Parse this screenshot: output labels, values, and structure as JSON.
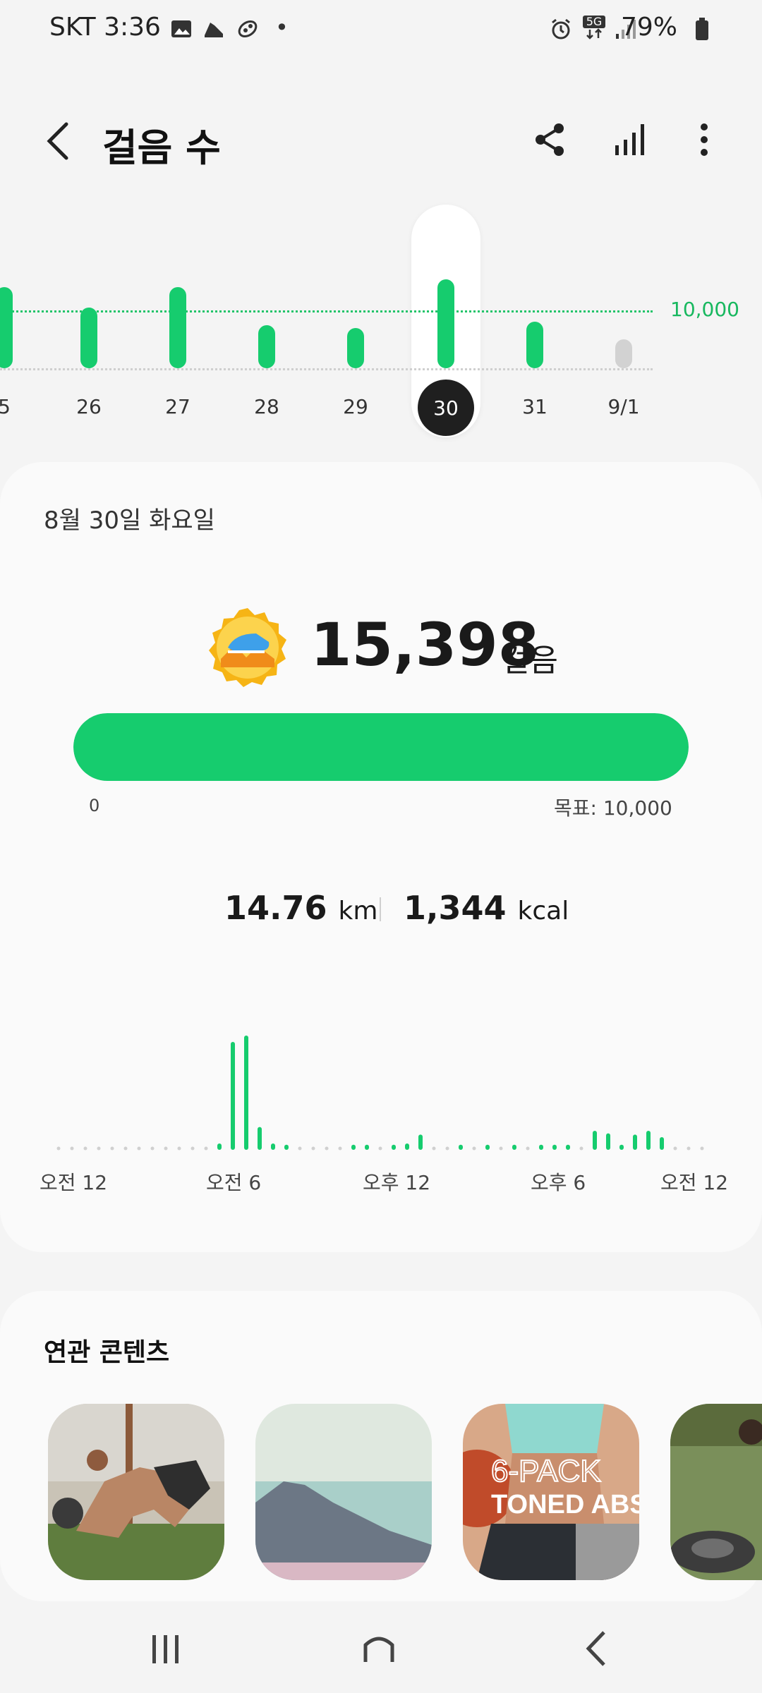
{
  "status_bar": {
    "carrier_time": "SKT 3:36",
    "battery": "79%",
    "net_badge": "5G",
    "dot": "•"
  },
  "header": {
    "title": "걸음 수"
  },
  "week_chart": {
    "goal_label": "10,000",
    "goal": 10000,
    "days": [
      {
        "label": "5",
        "value": 14000
      },
      {
        "label": "26",
        "value": 10500
      },
      {
        "label": "27",
        "value": 14000
      },
      {
        "label": "28",
        "value": 7500
      },
      {
        "label": "29",
        "value": 7000
      },
      {
        "label": "30",
        "value": 15398,
        "selected": true
      },
      {
        "label": "31",
        "value": 8000
      },
      {
        "label": "9/1",
        "value": 5000,
        "future": true
      }
    ]
  },
  "summary": {
    "date": "8월 30일 화요일",
    "steps": "15,398",
    "steps_unit": "걸음",
    "progress_fraction": 1.0,
    "progress_min": "0",
    "progress_goal": "목표: 10,000",
    "distance": "14.76",
    "distance_unit": "km",
    "calories": "1,344",
    "calories_unit": "kcal"
  },
  "hourly_chart": {
    "labels": [
      "오전 12",
      "오전 6",
      "오후 12",
      "오후 6",
      "오전 12"
    ],
    "values": [
      0,
      0,
      0,
      0,
      0,
      0,
      0,
      0,
      0,
      0,
      0,
      0,
      0.05,
      0.85,
      0.9,
      0.18,
      0.05,
      0.04,
      0,
      0,
      0,
      0,
      0.04,
      0.04,
      0,
      0.04,
      0.05,
      0.12,
      0,
      0,
      0.04,
      0,
      0.04,
      0,
      0.04,
      0,
      0.04,
      0.04,
      0.04,
      0,
      0.15,
      0.13,
      0.04,
      0.12,
      0.15,
      0.1,
      0,
      0,
      0,
      0.08,
      0.04
    ]
  },
  "related": {
    "title": "연관 콘텐츠",
    "thumb3_line1": "6-PACK",
    "thumb3_line2": "TONED ABS"
  },
  "colors": {
    "accent": "#16cc6e",
    "dark": "#1f1f1f",
    "bg": "#f4f4f4",
    "card": "#fafafa"
  }
}
